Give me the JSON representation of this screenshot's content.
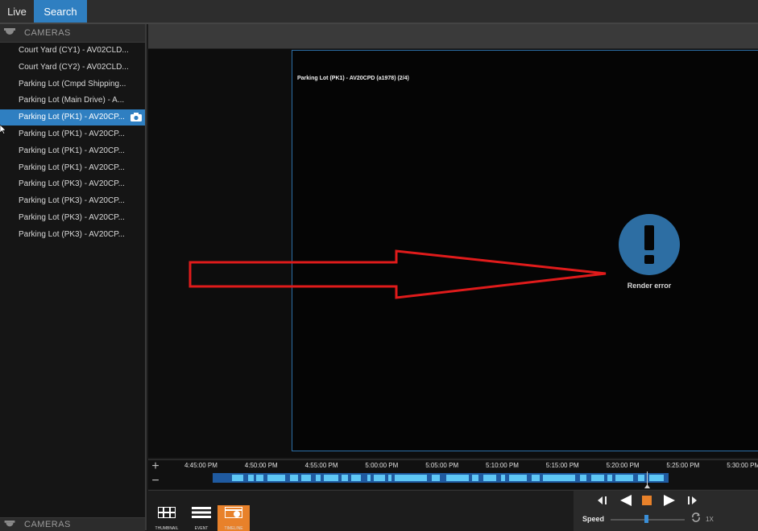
{
  "tabs": {
    "live": "Live",
    "search": "Search"
  },
  "sidebar": {
    "header": "CAMERAS",
    "footer": "CAMERAS",
    "cameras": [
      {
        "label": "Court Yard (CY1) - AV02CLD..."
      },
      {
        "label": "Court Yard (CY2) - AV02CLD..."
      },
      {
        "label": "Parking Lot (Cmpd Shipping..."
      },
      {
        "label": "Parking Lot (Main Drive) - A..."
      },
      {
        "label": "Parking Lot (PK1) - AV20CP...",
        "selected": true
      },
      {
        "label": "Parking Lot (PK1) - AV20CP..."
      },
      {
        "label": "Parking Lot (PK1) - AV20CP..."
      },
      {
        "label": "Parking Lot (PK1) - AV20CP..."
      },
      {
        "label": "Parking Lot (PK3) - AV20CP..."
      },
      {
        "label": "Parking Lot (PK3) - AV20CP..."
      },
      {
        "label": "Parking Lot (PK3) - AV20CP..."
      },
      {
        "label": "Parking Lot (PK3) - AV20CP..."
      }
    ]
  },
  "viewer": {
    "title": "Parking Lot (PK1) - AV20CPD (a1978) (2/4)",
    "error_text": "Render error"
  },
  "timeline": {
    "zoom_in": "+",
    "zoom_out": "−",
    "ticks": [
      "4:45:00 PM",
      "4:50:00 PM",
      "4:55:00 PM",
      "5:00:00 PM",
      "5:05:00 PM",
      "5:10:00 PM",
      "5:15:00 PM",
      "5:20:00 PM",
      "5:25:00 PM",
      "5:30:00 PM"
    ]
  },
  "modes": {
    "thumbnail": "THUMBNAIL",
    "event": "EVENT",
    "timeline": "TIMELINE"
  },
  "playback": {
    "speed_label": "Speed",
    "speed_value": "1X"
  },
  "colors": {
    "accent": "#2f7fc1",
    "timeline_bar": "#1f5aa0",
    "recording": "#5ec7f5",
    "active_mode": "#e8812a",
    "annotation_arrow": "#e01b1b"
  }
}
